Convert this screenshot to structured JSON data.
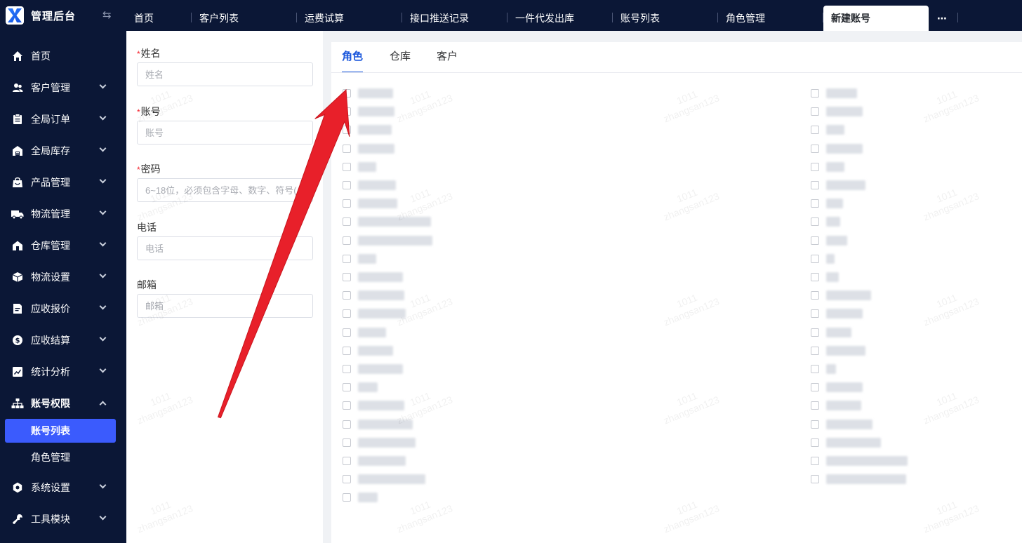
{
  "app": {
    "title": "管理后台"
  },
  "tabs": [
    {
      "label": "首页"
    },
    {
      "label": "客户列表"
    },
    {
      "label": "运费试算"
    },
    {
      "label": "接口推送记录"
    },
    {
      "label": "一件代发出库"
    },
    {
      "label": "账号列表"
    },
    {
      "label": "角色管理"
    },
    {
      "label": "新建账号",
      "active": true
    }
  ],
  "more_label": "⋯",
  "sidebar": {
    "items": [
      {
        "label": "首页",
        "icon": "home-icon"
      },
      {
        "label": "客户管理",
        "icon": "users-icon"
      },
      {
        "label": "全局订单",
        "icon": "clipboard-icon"
      },
      {
        "label": "全局库存",
        "icon": "warehouse-icon"
      },
      {
        "label": "产品管理",
        "icon": "bag-icon"
      },
      {
        "label": "物流管理",
        "icon": "truck-icon"
      },
      {
        "label": "仓库管理",
        "icon": "store-icon"
      },
      {
        "label": "物流设置",
        "icon": "box-icon"
      },
      {
        "label": "应收报价",
        "icon": "document-icon"
      },
      {
        "label": "应收结算",
        "icon": "coin-icon"
      },
      {
        "label": "统计分析",
        "icon": "chart-icon"
      },
      {
        "label": "账号权限",
        "icon": "org-icon",
        "expanded": true
      },
      {
        "label": "系统设置",
        "icon": "gear-icon"
      },
      {
        "label": "工具模块",
        "icon": "wrench-icon"
      }
    ],
    "sub_items": [
      {
        "label": "账号列表",
        "active": true
      },
      {
        "label": "角色管理"
      }
    ]
  },
  "form": {
    "name": {
      "label": "姓名",
      "placeholder": "姓名",
      "required": true
    },
    "account": {
      "label": "账号",
      "placeholder": "账号",
      "required": true
    },
    "password": {
      "label": "密码",
      "placeholder": "6~18位，必须包含字母、数字、符号(",
      "required": true
    },
    "phone": {
      "label": "电话",
      "placeholder": "电话",
      "required": false
    },
    "email": {
      "label": "邮箱",
      "placeholder": "邮箱",
      "required": false
    }
  },
  "panel_tabs": [
    {
      "label": "角色",
      "active": true
    },
    {
      "label": "仓库"
    },
    {
      "label": "客户"
    }
  ],
  "watermark": {
    "line1": "1011",
    "line2": "zhangsan123"
  },
  "colors": {
    "sidebar_bg": "#0b1736",
    "accent": "#3b5bfd",
    "tab_active": "#1a56db",
    "arrow": "#e8202a"
  }
}
